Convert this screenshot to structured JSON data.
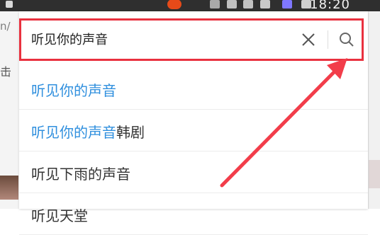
{
  "status_bar": {
    "time": "18:20"
  },
  "left_strip": {
    "edge_text": "击",
    "edge_text2": "n/"
  },
  "search": {
    "value": "听见你的声音",
    "placeholder": ""
  },
  "suggestions": [
    {
      "highlight": "听见你的声音",
      "rest": ""
    },
    {
      "highlight": "听见你的声音",
      "rest": "韩剧"
    },
    {
      "highlight": "",
      "rest": "听见下雨的声音"
    },
    {
      "highlight": "",
      "rest": "听见天堂"
    }
  ],
  "colors": {
    "highlight_box": "#e9313f",
    "arrow": "#f23d4a",
    "match_text": "#2f8fde"
  },
  "icons": {
    "clear": "close-icon",
    "search": "search-icon"
  }
}
